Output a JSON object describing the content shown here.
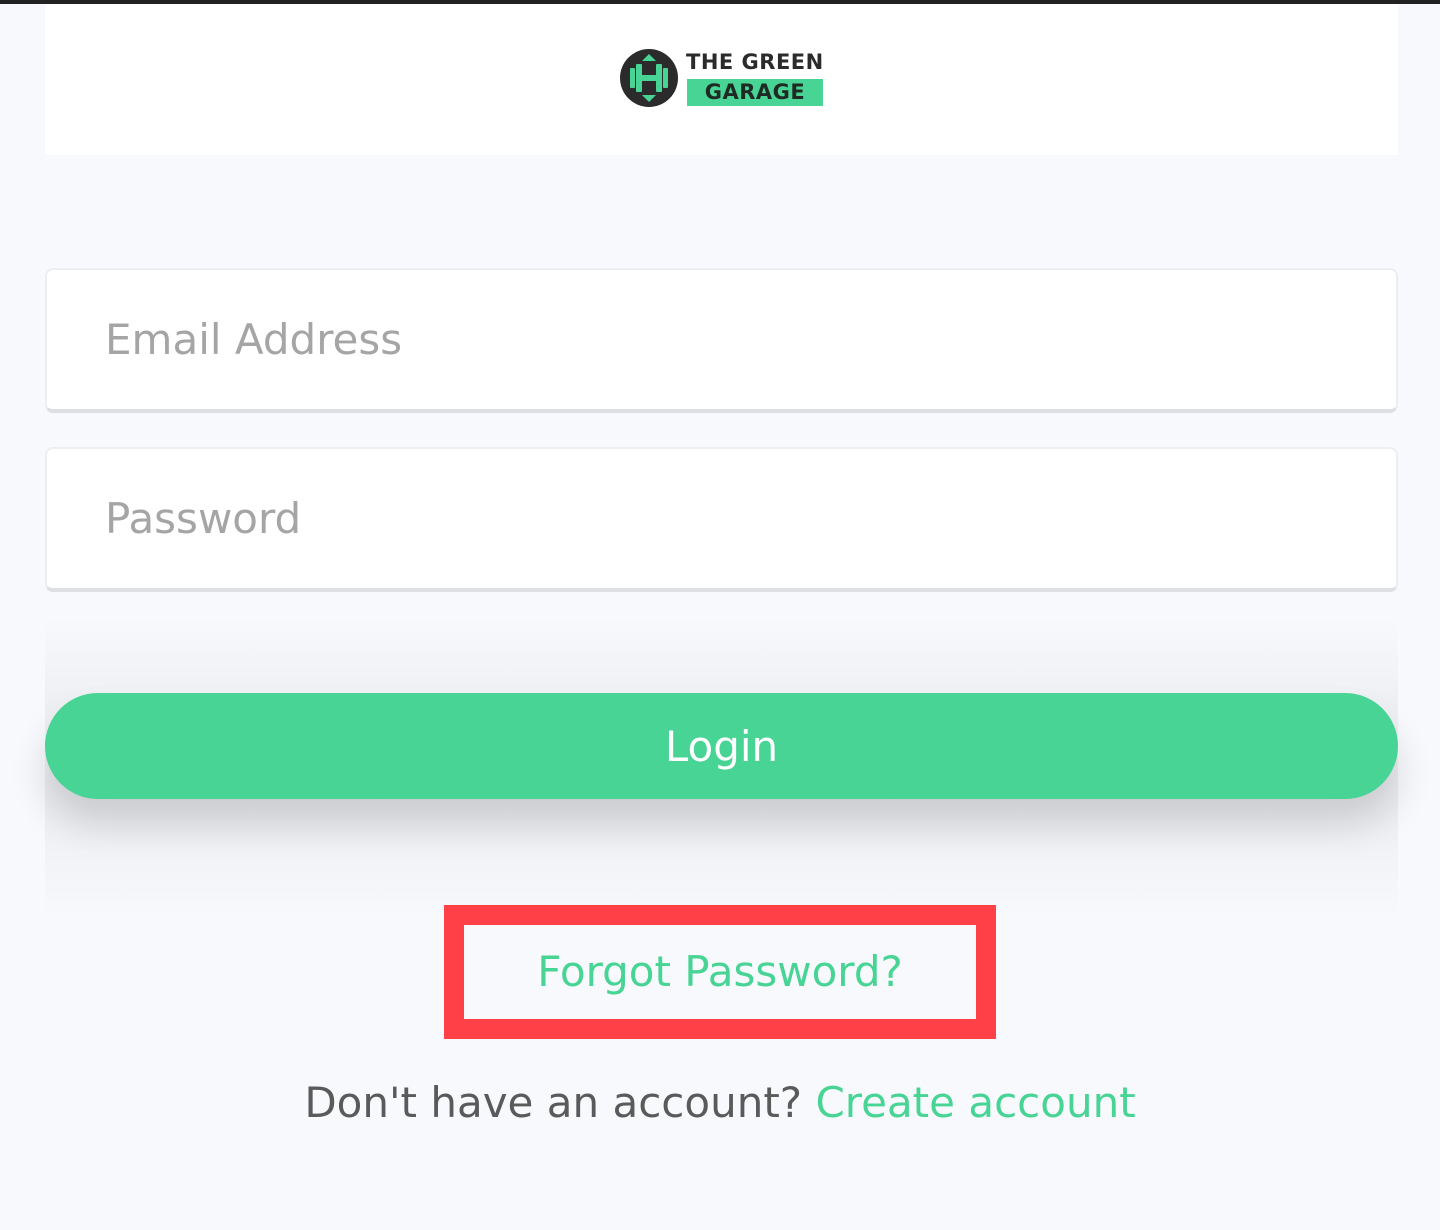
{
  "brand": {
    "line1": "THE GREEN",
    "line2": "GARAGE",
    "accent_color": "#47d494",
    "dark_color": "#2b2b2b",
    "icon": "dumbbell-icon"
  },
  "form": {
    "email_placeholder": "Email Address",
    "email_value": "",
    "password_placeholder": "Password",
    "password_value": "",
    "login_label": "Login"
  },
  "links": {
    "forgot_password": "Forgot Password?",
    "signup_prompt": "Don't have an account?",
    "create_account": "Create account"
  },
  "highlight_color": "#ff4046"
}
